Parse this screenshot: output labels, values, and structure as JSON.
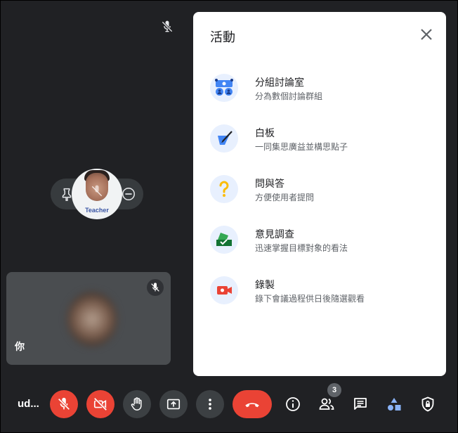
{
  "main": {
    "self_tile": {
      "name": "你"
    },
    "teacher_tile": {
      "label": "Teacher"
    }
  },
  "activities_panel": {
    "title": "活動",
    "items": [
      {
        "title": "分組討論室",
        "subtitle": "分為數個討論群組",
        "icon": "breakout-rooms-icon"
      },
      {
        "title": "白板",
        "subtitle": "一同集思廣益並構思點子",
        "icon": "whiteboard-icon"
      },
      {
        "title": "問與答",
        "subtitle": "方便使用者提問",
        "icon": "qa-icon"
      },
      {
        "title": "意見調查",
        "subtitle": "迅速掌握目標對象的看法",
        "icon": "poll-icon"
      },
      {
        "title": "錄製",
        "subtitle": "錄下會議過程供日後隨選觀看",
        "icon": "recording-icon"
      }
    ]
  },
  "bottom_bar": {
    "meeting_code": "ud...",
    "participant_count": "3",
    "icons": [
      "mic-off-icon",
      "camera-off-icon",
      "raise-hand-icon",
      "present-screen-icon",
      "more-options-icon",
      "end-call-icon",
      "info-icon",
      "people-icon",
      "chat-icon",
      "activities-icon",
      "host-controls-icon"
    ]
  },
  "colors": {
    "background": "#202124",
    "danger": "#ea4335",
    "accent": "#1a73e8",
    "panel": "#ffffff"
  }
}
